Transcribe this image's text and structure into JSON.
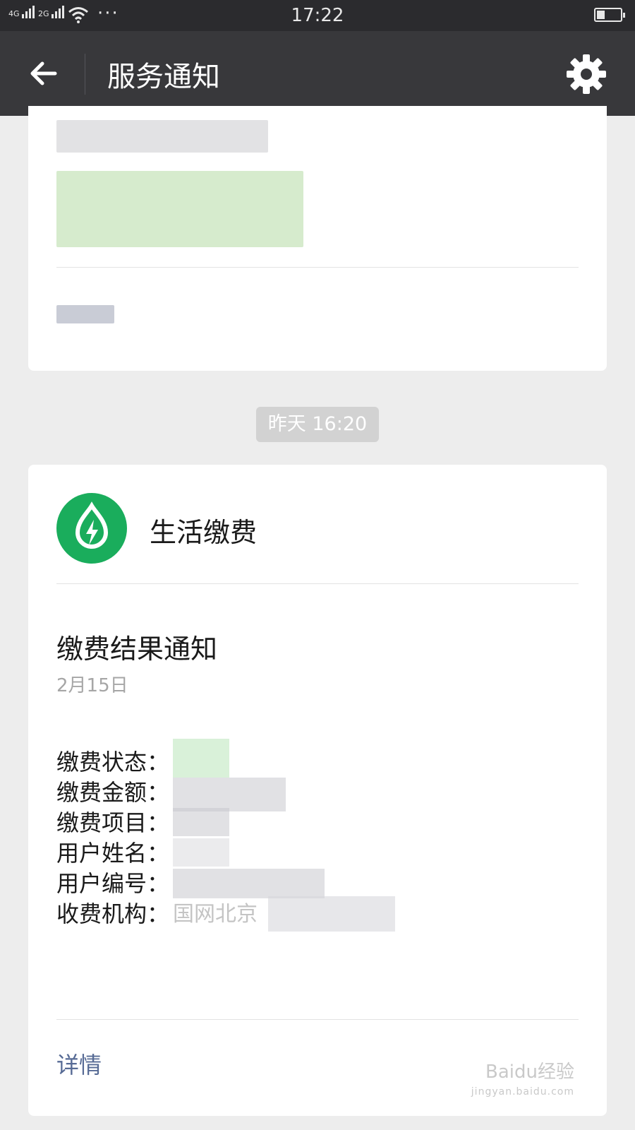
{
  "status_bar": {
    "network_1": "4G",
    "network_2": "2G",
    "more": "···",
    "time": "17:22",
    "battery_level": 0.35
  },
  "nav": {
    "back_icon": "arrow-left-icon",
    "title": "服务通知",
    "settings_icon": "gear-icon"
  },
  "timestamp": "昨天 16:20",
  "notification": {
    "service_icon": "lightning-drop-icon",
    "service_name": "生活缴费",
    "title": "缴费结果通知",
    "date": "2月15日",
    "fields": [
      {
        "label": "缴费状态：",
        "value": ""
      },
      {
        "label": "缴费金额：",
        "value": ""
      },
      {
        "label": "缴费项目：",
        "value": ""
      },
      {
        "label": "用户姓名：",
        "value": ""
      },
      {
        "label": "用户编号：",
        "value": ""
      },
      {
        "label": "收费机构：",
        "value": "国网北京"
      }
    ],
    "detail_link": "详情"
  },
  "watermark": {
    "line1": "Baidu经验",
    "line2": "jingyan.baidu.com"
  },
  "colors": {
    "status_bar": "#2b2b2e",
    "nav_bar": "#38383b",
    "background": "#ededed",
    "brand_green": "#1aad5c",
    "link": "#576b95"
  }
}
